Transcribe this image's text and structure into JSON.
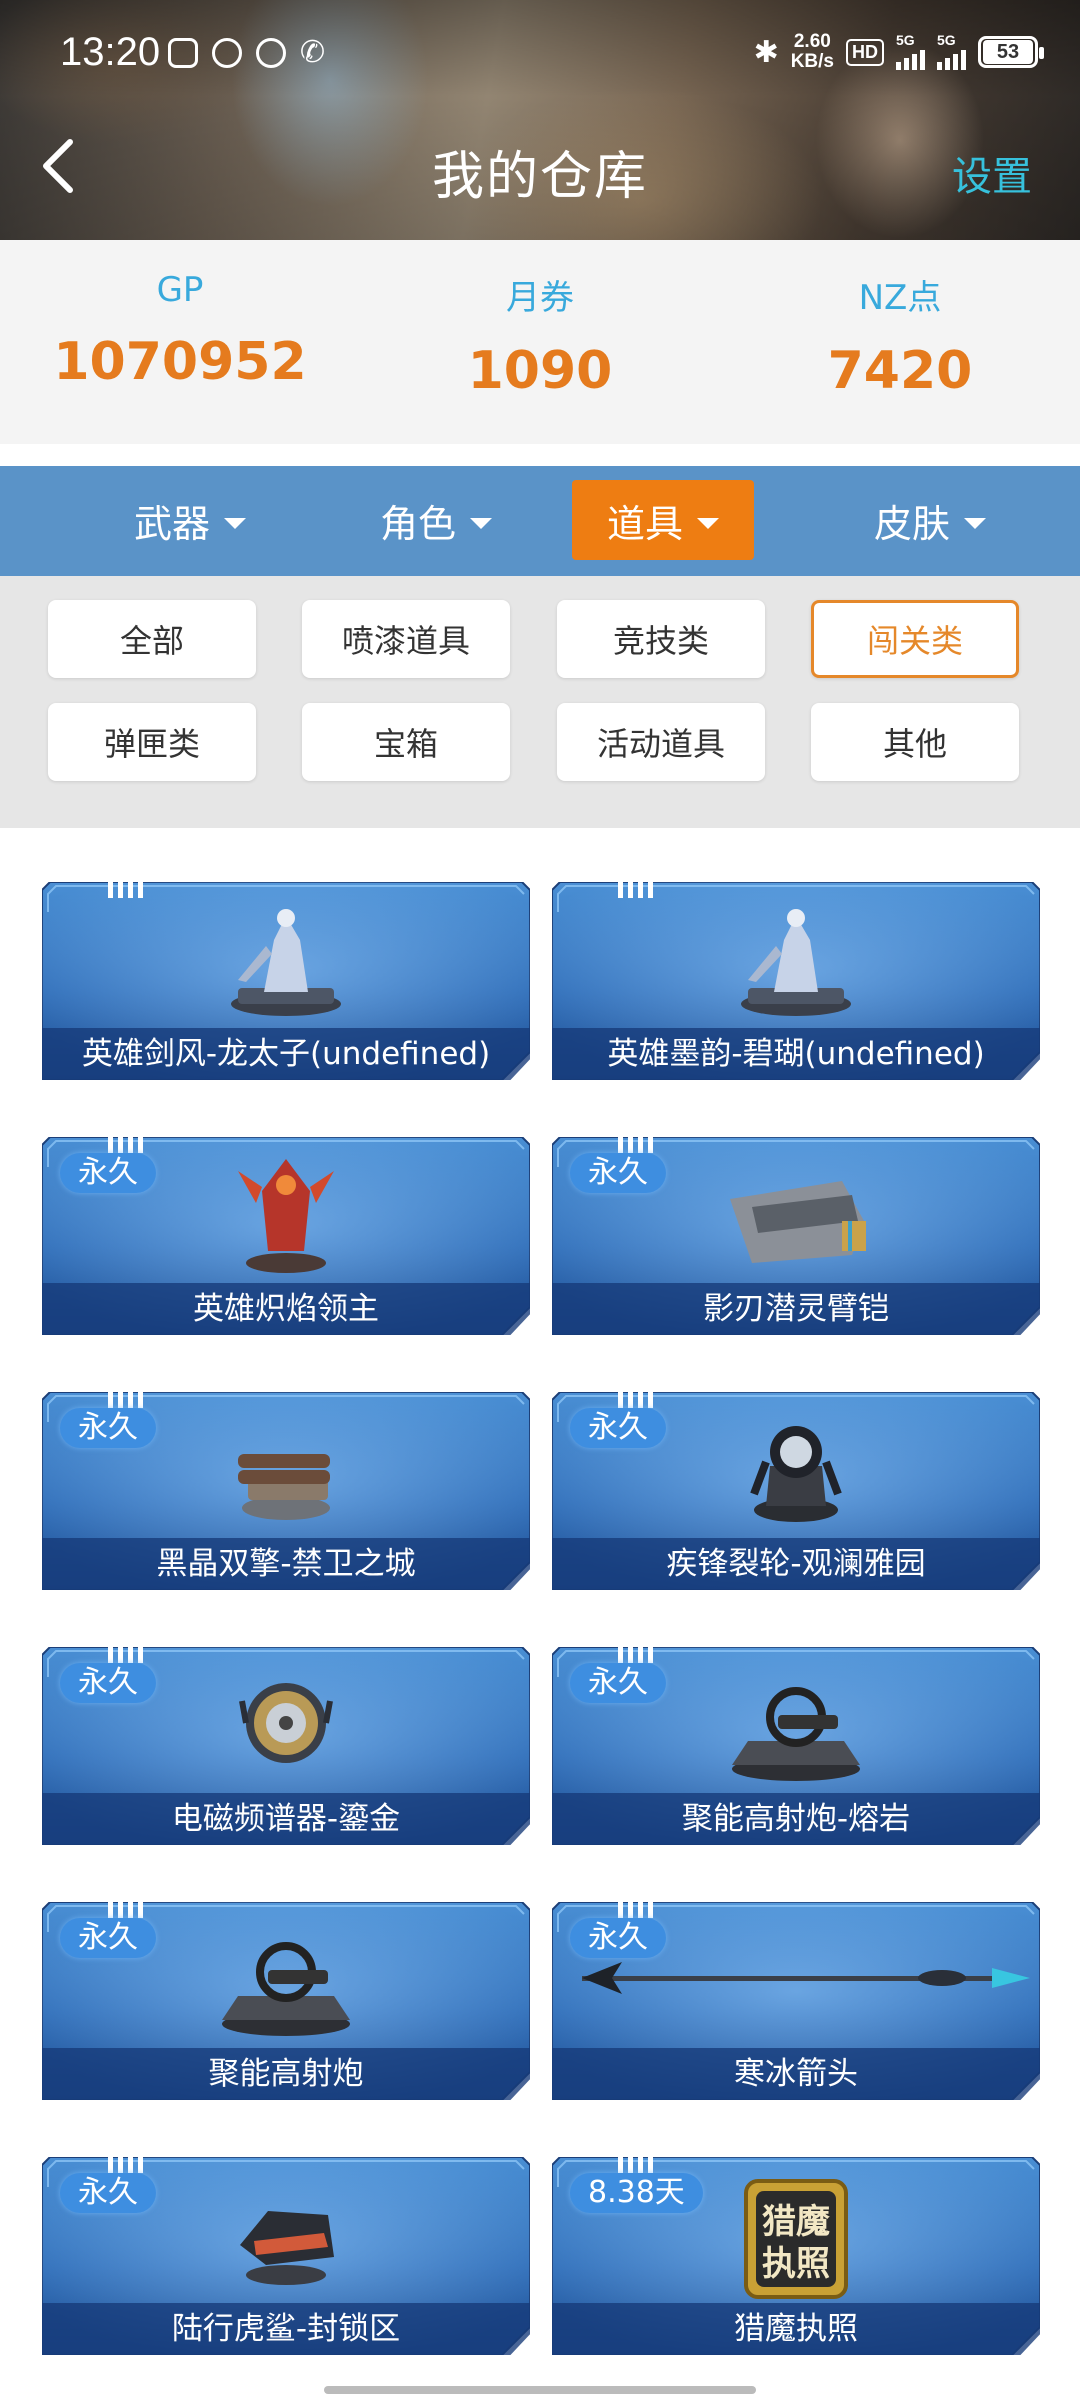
{
  "status_bar": {
    "time": "13:20",
    "net_speed_value": "2.60",
    "net_speed_unit": "KB/s",
    "hd_label": "HD",
    "signal_1": "5G",
    "signal_2": "5G",
    "battery": "53",
    "icons": [
      "game-controller-icon",
      "sync-icon",
      "play-icon",
      "call-icon",
      "bluetooth-icon"
    ]
  },
  "header": {
    "title": "我的仓库",
    "settings": "设置",
    "back_icon": "chevron-left-icon"
  },
  "currency": [
    {
      "label": "GP",
      "value": "1070952"
    },
    {
      "label": "月券",
      "value": "1090"
    },
    {
      "label": "NZ点",
      "value": "7420"
    }
  ],
  "categories": [
    {
      "label": "武器",
      "active": false
    },
    {
      "label": "角色",
      "active": false
    },
    {
      "label": "道具",
      "active": true
    },
    {
      "label": "皮肤",
      "active": false
    }
  ],
  "filters": [
    {
      "label": "全部",
      "active": false
    },
    {
      "label": "喷漆道具",
      "active": false
    },
    {
      "label": "竞技类",
      "active": false
    },
    {
      "label": "闯关类",
      "active": true
    },
    {
      "label": "弹匣类",
      "active": false
    },
    {
      "label": "宝箱",
      "active": false
    },
    {
      "label": "活动道具",
      "active": false
    },
    {
      "label": "其他",
      "active": false
    }
  ],
  "items": [
    {
      "name": "英雄剑风-龙太子(undefined)",
      "badge": "",
      "icon": "hero-statue-icon"
    },
    {
      "name": "英雄墨韵-碧瑚(undefined)",
      "badge": "",
      "icon": "hero-statue-icon"
    },
    {
      "name": "英雄炽焰领主",
      "badge": "永久",
      "icon": "fire-lord-icon"
    },
    {
      "name": "影刃潜灵臂铠",
      "badge": "永久",
      "icon": "arm-gauntlet-icon"
    },
    {
      "name": "黑晶双擎-禁卫之城",
      "badge": "永久",
      "icon": "twin-cannon-icon"
    },
    {
      "name": "疾锋裂轮-观澜雅园",
      "badge": "永久",
      "icon": "wheel-turret-icon"
    },
    {
      "name": "电磁频谱器-鎏金",
      "badge": "永久",
      "icon": "spectrum-device-icon"
    },
    {
      "name": "聚能高射炮-熔岩",
      "badge": "永久",
      "icon": "anti-air-cannon-icon"
    },
    {
      "name": "聚能高射炮",
      "badge": "永久",
      "icon": "anti-air-cannon-icon"
    },
    {
      "name": "寒冰箭头",
      "badge": "永久",
      "icon": "ice-arrow-icon"
    },
    {
      "name": "陆行虎鲨-封锁区",
      "badge": "永久",
      "icon": "tiger-shark-turret-icon"
    },
    {
      "name": "猎魔执照",
      "badge": "8.38天",
      "icon": "hunter-license-icon",
      "license_text": "猎魔执照"
    }
  ]
}
